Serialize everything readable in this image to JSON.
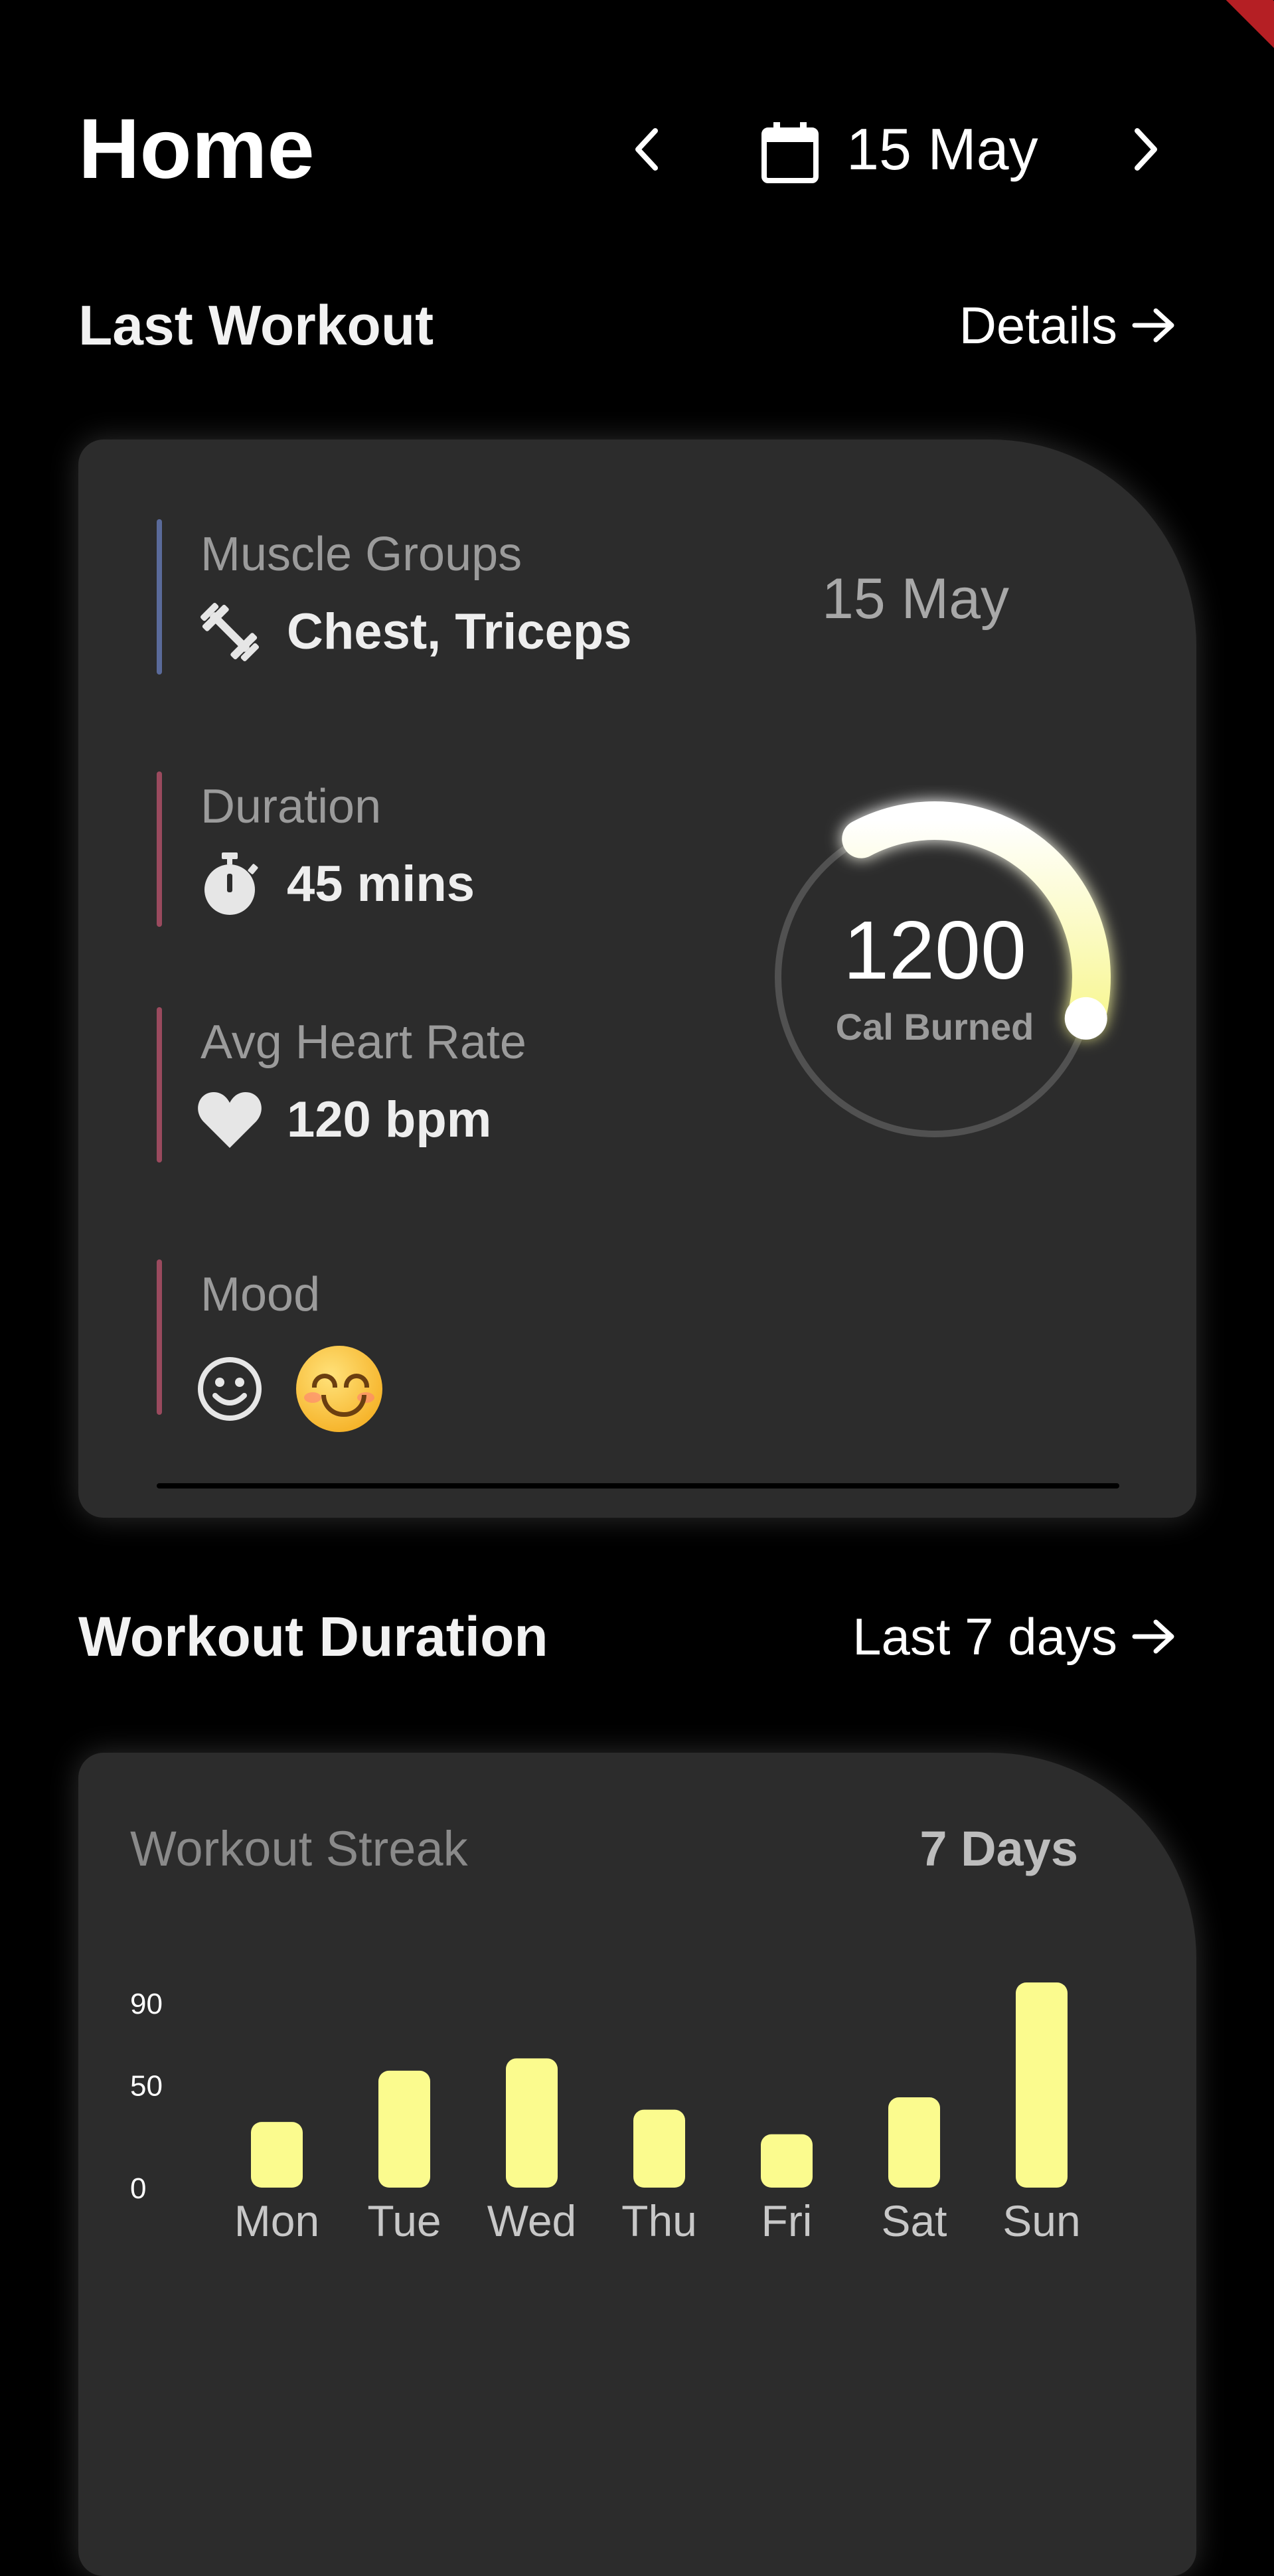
{
  "header": {
    "title": "Home",
    "date": "15 May",
    "prev_icon": "chevron-left-icon",
    "next_icon": "chevron-right-icon",
    "calendar_icon": "calendar-icon"
  },
  "last_workout": {
    "section_title": "Last Workout",
    "link_label": "Details",
    "date": "15 May",
    "muscle_groups": {
      "label": "Muscle Groups",
      "value": "Chest, Triceps",
      "icon": "dumbbell-icon",
      "color": "#5a6a9a"
    },
    "duration": {
      "label": "Duration",
      "value": "45 mins",
      "icon": "stopwatch-icon",
      "color": "#9a4a5e"
    },
    "heart_rate": {
      "label": "Avg Heart Rate",
      "value": "120 bpm",
      "icon": "heart-icon",
      "color": "#9a4a5e"
    },
    "mood": {
      "label": "Mood",
      "icons": [
        "smiley-outline-icon",
        "smiling-face-emoji-icon"
      ],
      "color": "#9a4a5e"
    },
    "calories": {
      "value": "1200",
      "label": "Cal Burned",
      "progress": 0.37
    },
    "accent": "#fbfb9a"
  },
  "workout_duration": {
    "section_title": "Workout Duration",
    "link_label": "Last 7 days",
    "streak_label": "Workout Streak",
    "streak_value": "7 Days"
  },
  "chart_data": {
    "type": "bar",
    "categories": [
      "Mon",
      "Tue",
      "Wed",
      "Thu",
      "Fri",
      "Sat",
      "Sun"
    ],
    "values": [
      32,
      57,
      63,
      38,
      26,
      44,
      100
    ],
    "yticks": [
      0,
      50,
      90
    ],
    "ylim": [
      0,
      100
    ],
    "title": "",
    "xlabel": "",
    "ylabel": "",
    "grid": false,
    "bar_color": "#fbfb8e"
  }
}
